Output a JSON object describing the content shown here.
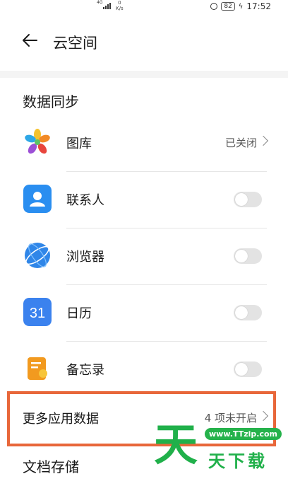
{
  "status_bar": {
    "network": "4G",
    "speed_value": "0",
    "speed_unit": "K/s",
    "battery": "82",
    "time": "17:52"
  },
  "header": {
    "title": "云空间"
  },
  "sections": {
    "data_sync": {
      "title": "数据同步",
      "items": [
        {
          "label": "图库",
          "status": "已关闭"
        },
        {
          "label": "联系人",
          "toggle": "off"
        },
        {
          "label": "浏览器",
          "toggle": "off"
        },
        {
          "label": "日历",
          "toggle": "off",
          "icon_text": "31"
        },
        {
          "label": "备忘录",
          "toggle": "off"
        }
      ],
      "more": {
        "label": "更多应用数据",
        "status": "4 项未开启"
      }
    },
    "doc_storage": {
      "title": "文档存储"
    }
  },
  "watermark": {
    "url": "www.TTzip.com",
    "big": "天",
    "text": "天下载"
  },
  "colors": {
    "highlight": "#e8673a",
    "watermark": "#20b04a",
    "contacts_icon": "#2a8ef0",
    "calendar_icon": "#3b82ee",
    "browser_icon": "#2f86e8",
    "notes_icon": "#f29a1f"
  }
}
